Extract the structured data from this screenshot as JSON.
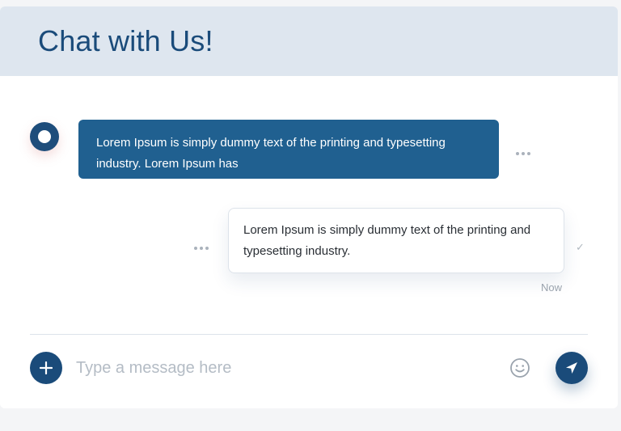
{
  "header": {
    "title": "Chat with Us!"
  },
  "messages": [
    {
      "direction": "incoming",
      "text": "Lorem Ipsum is simply dummy text of the printing and typesetting industry. Lorem Ipsum has"
    },
    {
      "direction": "outgoing",
      "text": "Lorem Ipsum is simply dummy text of the printing and typesetting industry.",
      "time": "Now",
      "status_icon": "check-icon"
    }
  ],
  "composer": {
    "placeholder": "Type a message here",
    "add_icon": "plus-icon",
    "emoji_icon": "smiley-icon",
    "send_icon": "paper-plane-icon"
  },
  "colors": {
    "header_bg": "#dee6ef",
    "primary": "#1a4b7a",
    "incoming_bubble": "#206090"
  }
}
